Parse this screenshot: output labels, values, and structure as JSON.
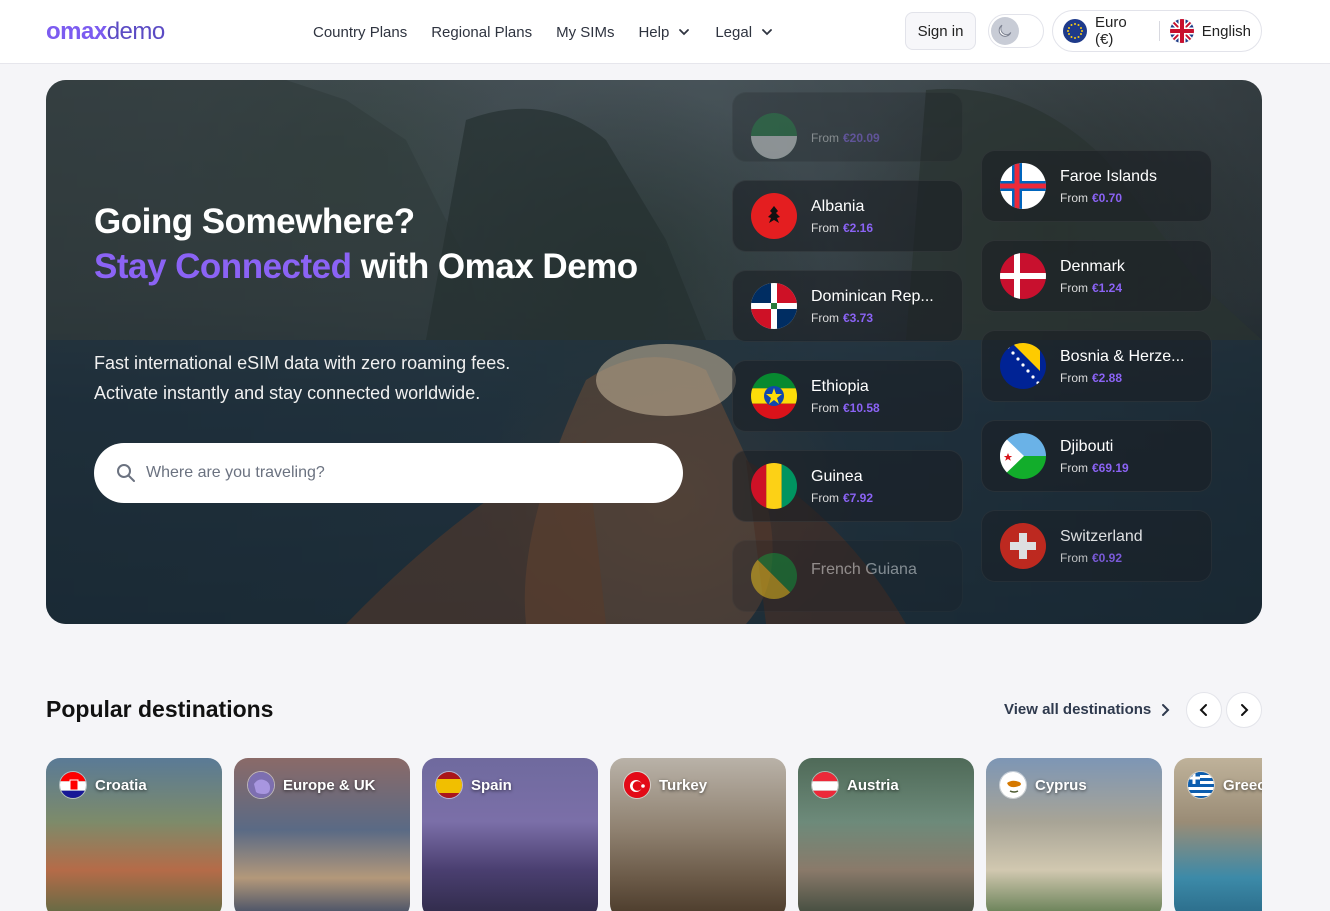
{
  "header": {
    "logo_mark": "omax",
    "logo_word": "demo",
    "nav": {
      "country_plans": "Country Plans",
      "regional_plans": "Regional Plans",
      "my_sims": "My SIMs",
      "help": "Help",
      "legal": "Legal"
    },
    "sign_in": "Sign in",
    "currency": "Euro (€)",
    "language": "English"
  },
  "hero": {
    "title_line1": "Going Somewhere?",
    "title_accent": "Stay Connected",
    "title_rest": " with Omax Demo",
    "subtitle_line1": "Fast international eSIM data with zero roaming fees.",
    "subtitle_line2": "Activate instantly and stay connected worldwide.",
    "search_placeholder": "Where are you traveling?",
    "from_label": "From",
    "left_column": [
      {
        "name": "",
        "price": "€20.09"
      },
      {
        "name": "Albania",
        "price": "€2.16"
      },
      {
        "name": "Dominican Rep...",
        "price": "€3.73"
      },
      {
        "name": "Ethiopia",
        "price": "€10.58"
      },
      {
        "name": "Guinea",
        "price": "€7.92"
      },
      {
        "name": "French Guiana",
        "price": ""
      }
    ],
    "right_column": [
      {
        "name": "Faroe Islands",
        "price": "€0.70"
      },
      {
        "name": "Denmark",
        "price": "€1.24"
      },
      {
        "name": "Bosnia & Herze...",
        "price": "€2.88"
      },
      {
        "name": "Djibouti",
        "price": "€69.19"
      },
      {
        "name": "Switzerland",
        "price": "€0.92"
      }
    ]
  },
  "popular": {
    "title": "Popular destinations",
    "view_all": "View all destinations",
    "destinations": [
      {
        "name": "Croatia"
      },
      {
        "name": "Europe & UK"
      },
      {
        "name": "Spain"
      },
      {
        "name": "Turkey"
      },
      {
        "name": "Austria"
      },
      {
        "name": "Cyprus"
      },
      {
        "name": "Greece"
      }
    ]
  },
  "colors": {
    "accent": "#8b63f5",
    "brand_dark": "#3a2e7a"
  }
}
